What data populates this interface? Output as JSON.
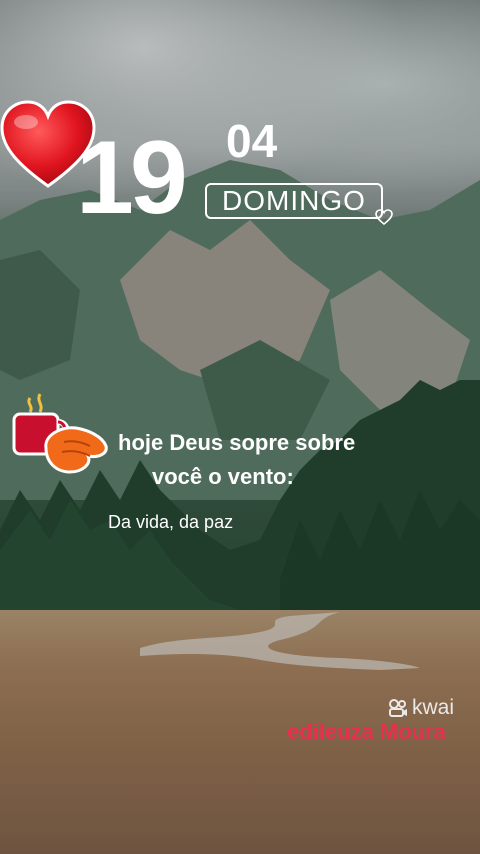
{
  "date": {
    "day": "19",
    "month": "04",
    "weekday": "DOMINGO"
  },
  "message": {
    "line1": "hoje Deus sopre sobre",
    "line2": "você o vento:",
    "line3": "Da vida, da paz"
  },
  "watermark": {
    "brand": "kwai",
    "author": "edileuza Moura"
  },
  "colors": {
    "heart": "#e0141f",
    "author": "#e5304e",
    "text": "#ffffff"
  },
  "icons": [
    "heart-icon",
    "small-heart-icon",
    "coffee-mug-icon",
    "hand-icon",
    "kwai-logo-icon"
  ]
}
